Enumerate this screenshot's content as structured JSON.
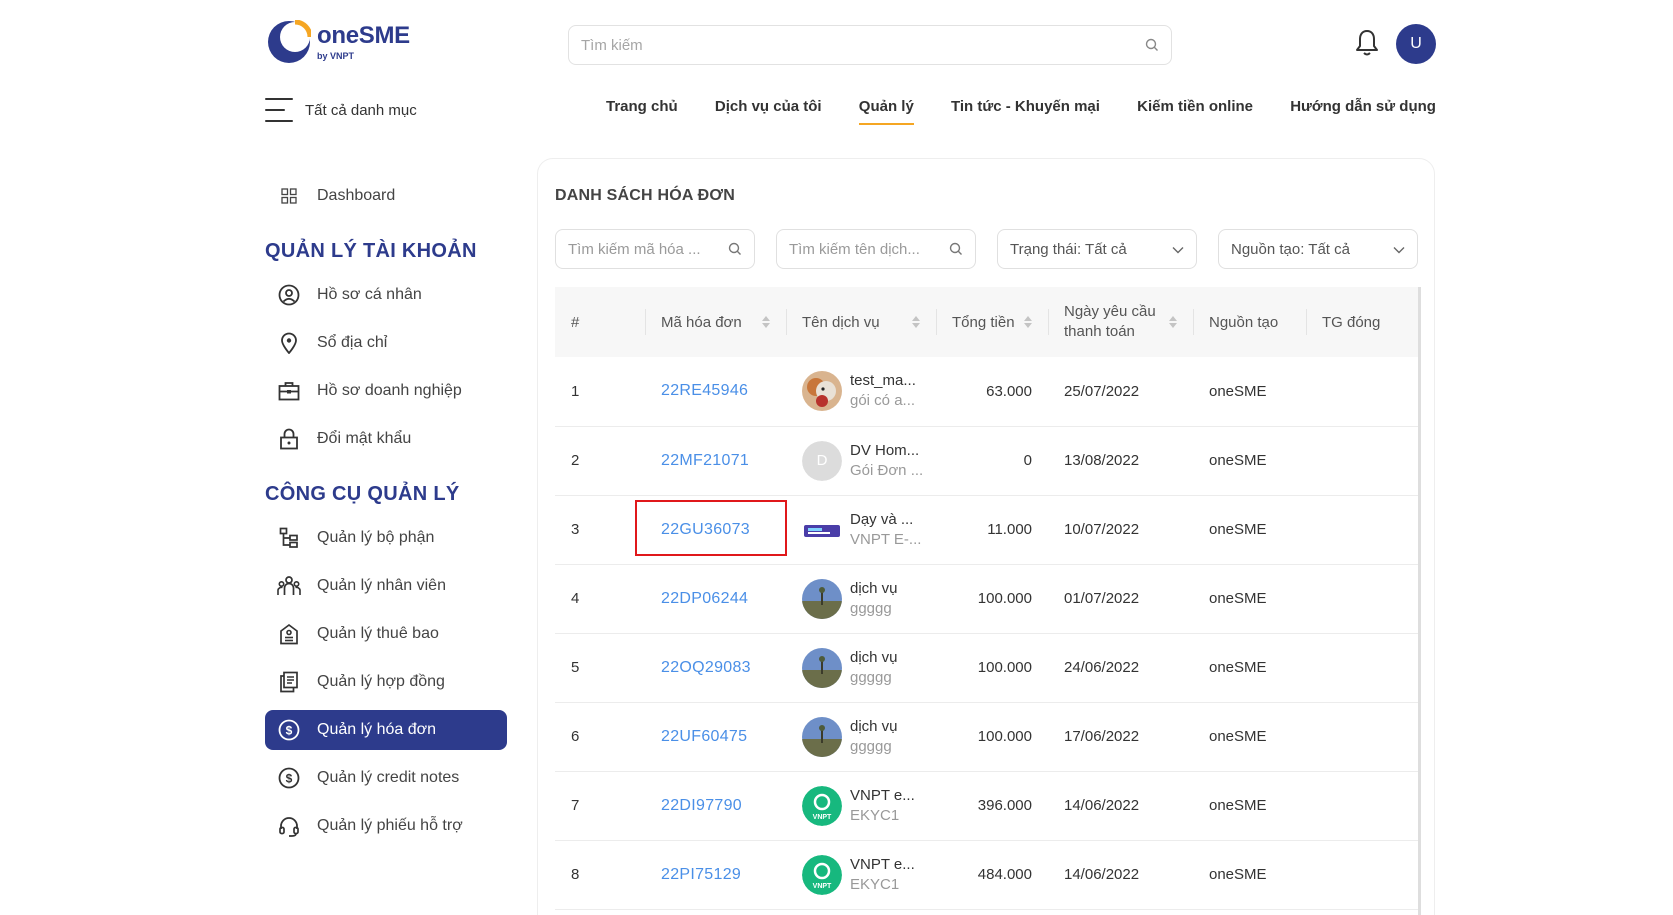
{
  "header": {
    "logo_main": "oneSME",
    "logo_sub": "by VNPT",
    "search_placeholder": "Tìm kiếm",
    "avatar_letter": "U",
    "all_categories": "Tất cả danh mục",
    "nav": [
      {
        "label": "Trang chủ",
        "active": false
      },
      {
        "label": "Dịch vụ của tôi",
        "active": false
      },
      {
        "label": "Quản lý",
        "active": true
      },
      {
        "label": "Tin tức - Khuyến mại",
        "active": false
      },
      {
        "label": "Kiếm tiền online",
        "active": false
      },
      {
        "label": "Hướng dẫn sử dụng",
        "active": false
      }
    ]
  },
  "sidebar": {
    "dashboard": "Dashboard",
    "account_heading": "QUẢN LÝ TÀI KHOẢN",
    "account_items": [
      {
        "label": "Hồ sơ cá nhân",
        "icon": "user-circle-icon"
      },
      {
        "label": "Sổ địa chỉ",
        "icon": "location-pin-icon"
      },
      {
        "label": "Hồ sơ doanh nghiệp",
        "icon": "briefcase-icon"
      },
      {
        "label": "Đổi mật khẩu",
        "icon": "lock-icon"
      }
    ],
    "tools_heading": "CÔNG CỤ QUẢN LÝ",
    "tools_items": [
      {
        "label": "Quản lý bộ phận",
        "icon": "org-tree-icon",
        "active": false
      },
      {
        "label": "Quản lý nhân viên",
        "icon": "team-icon",
        "active": false
      },
      {
        "label": "Quản lý thuê bao",
        "icon": "subscription-icon",
        "active": false
      },
      {
        "label": "Quản lý hợp đồng",
        "icon": "contract-icon",
        "active": false
      },
      {
        "label": "Quản lý hóa đơn",
        "icon": "dollar-circle-icon",
        "active": true
      },
      {
        "label": "Quản lý credit notes",
        "icon": "dollar-circle-icon",
        "active": false
      },
      {
        "label": "Quản lý phiếu hỗ trợ",
        "icon": "headset-icon",
        "active": false
      }
    ]
  },
  "main": {
    "title": "DANH SÁCH HÓA ĐƠN",
    "filters": {
      "search_code_placeholder": "Tìm kiếm mã hóa ...",
      "search_service_placeholder": "Tìm kiếm tên dịch...",
      "status": "Trạng thái: Tất cả",
      "source": "Nguồn tạo: Tất cả"
    },
    "columns": [
      "#",
      "Mã hóa đơn",
      "Tên dịch vụ",
      "Tổng tiền",
      "Ngày yêu cầu thanh toán",
      "Nguồn tạo",
      "TG đóng"
    ],
    "rows": [
      {
        "idx": "1",
        "code": "22RE45946",
        "svc_name": "test_ma...",
        "svc_pkg": "gói có a...",
        "thumb": "dog-photo",
        "total": "63.000",
        "date": "25/07/2022",
        "source": "oneSME"
      },
      {
        "idx": "2",
        "code": "22MF21071",
        "svc_name": "DV Hom...",
        "svc_pkg": "Gói Đơn ...",
        "thumb": "letter-D",
        "total": "0",
        "date": "13/08/2022",
        "source": "oneSME"
      },
      {
        "idx": "3",
        "code": "22GU36073",
        "svc_name": "Dạy và ...",
        "svc_pkg": "VNPT E-...",
        "thumb": "banner",
        "total": "11.000",
        "date": "10/07/2022",
        "source": "oneSME"
      },
      {
        "idx": "4",
        "code": "22DP06244",
        "svc_name": "dịch vụ",
        "svc_pkg": "ggggg",
        "thumb": "landscape",
        "total": "100.000",
        "date": "01/07/2022",
        "source": "oneSME"
      },
      {
        "idx": "5",
        "code": "22OQ29083",
        "svc_name": "dịch vụ",
        "svc_pkg": "ggggg",
        "thumb": "landscape",
        "total": "100.000",
        "date": "24/06/2022",
        "source": "oneSME"
      },
      {
        "idx": "6",
        "code": "22UF60475",
        "svc_name": "dịch vụ",
        "svc_pkg": "ggggg",
        "thumb": "landscape",
        "total": "100.000",
        "date": "17/06/2022",
        "source": "oneSME"
      },
      {
        "idx": "7",
        "code": "22DI97790",
        "svc_name": "VNPT e...",
        "svc_pkg": "EKYC1",
        "thumb": "vnpt-logo",
        "total": "396.000",
        "date": "14/06/2022",
        "source": "oneSME"
      },
      {
        "idx": "8",
        "code": "22PI75129",
        "svc_name": "VNPT e...",
        "svc_pkg": "EKYC1",
        "thumb": "vnpt-logo",
        "total": "484.000",
        "date": "14/06/2022",
        "source": "oneSME"
      }
    ]
  },
  "colors": {
    "brand": "#2d3b8c",
    "accent": "#f5a623",
    "link": "#4a8fe7",
    "highlight": "#e0181b"
  }
}
